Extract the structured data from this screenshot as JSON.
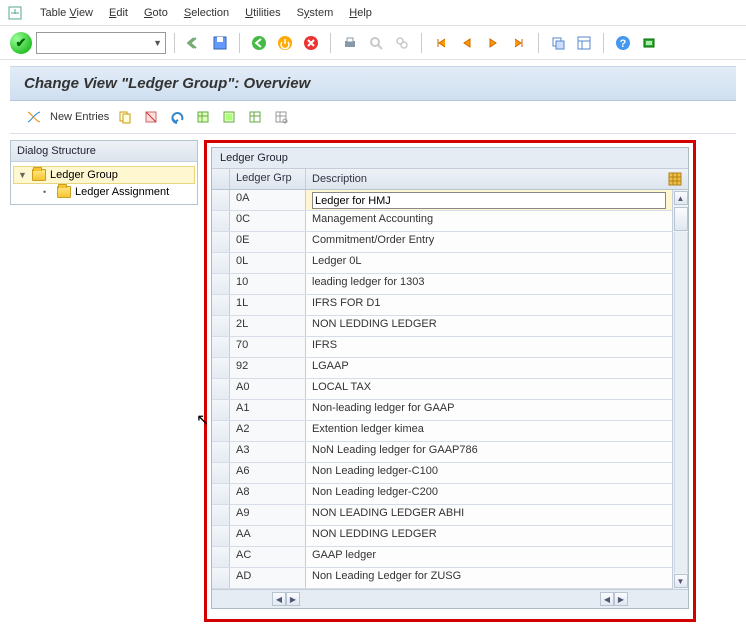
{
  "menu": {
    "items": [
      "Table View",
      "Edit",
      "Goto",
      "Selection",
      "Utilities",
      "System",
      "Help"
    ],
    "underline_idx": [
      6,
      0,
      0,
      0,
      0,
      1,
      0
    ]
  },
  "titlebar": {
    "title": "Change View \"Ledger Group\": Overview"
  },
  "subtoolbar": {
    "new_entries": "New Entries"
  },
  "tree": {
    "header": "Dialog Structure",
    "items": [
      {
        "label": "Ledger Group",
        "selected": true,
        "expandable": true
      },
      {
        "label": "Ledger Assignment",
        "selected": false,
        "expandable": false
      }
    ]
  },
  "grid": {
    "title": "Ledger Group",
    "col_grp": "Ledger Grp",
    "col_desc": "Description",
    "active_row": 0,
    "rows": [
      {
        "grp": "0A",
        "desc": "Ledger for HMJ"
      },
      {
        "grp": "0C",
        "desc": "Management Accounting"
      },
      {
        "grp": "0E",
        "desc": "Commitment/Order Entry"
      },
      {
        "grp": "0L",
        "desc": "Ledger 0L"
      },
      {
        "grp": "10",
        "desc": "leading ledger for 1303"
      },
      {
        "grp": "1L",
        "desc": "IFRS FOR D1"
      },
      {
        "grp": "2L",
        "desc": "NON LEDDING LEDGER"
      },
      {
        "grp": "70",
        "desc": "IFRS"
      },
      {
        "grp": "92",
        "desc": "LGAAP"
      },
      {
        "grp": "A0",
        "desc": "LOCAL TAX"
      },
      {
        "grp": "A1",
        "desc": "Non-leading ledger for GAAP"
      },
      {
        "grp": "A2",
        "desc": "Extention ledger kimea"
      },
      {
        "grp": "A3",
        "desc": "NoN Leading ledger for GAAP786"
      },
      {
        "grp": "A6",
        "desc": "Non Leading ledger-C100"
      },
      {
        "grp": "A8",
        "desc": "Non Leading ledger-C200"
      },
      {
        "grp": "A9",
        "desc": "NON LEADING LEDGER ABHI"
      },
      {
        "grp": "AA",
        "desc": "NON LEDDING LEDGER"
      },
      {
        "grp": "AC",
        "desc": "GAAP ledger"
      },
      {
        "grp": "AD",
        "desc": "Non Leading Ledger for ZUSG"
      }
    ]
  }
}
